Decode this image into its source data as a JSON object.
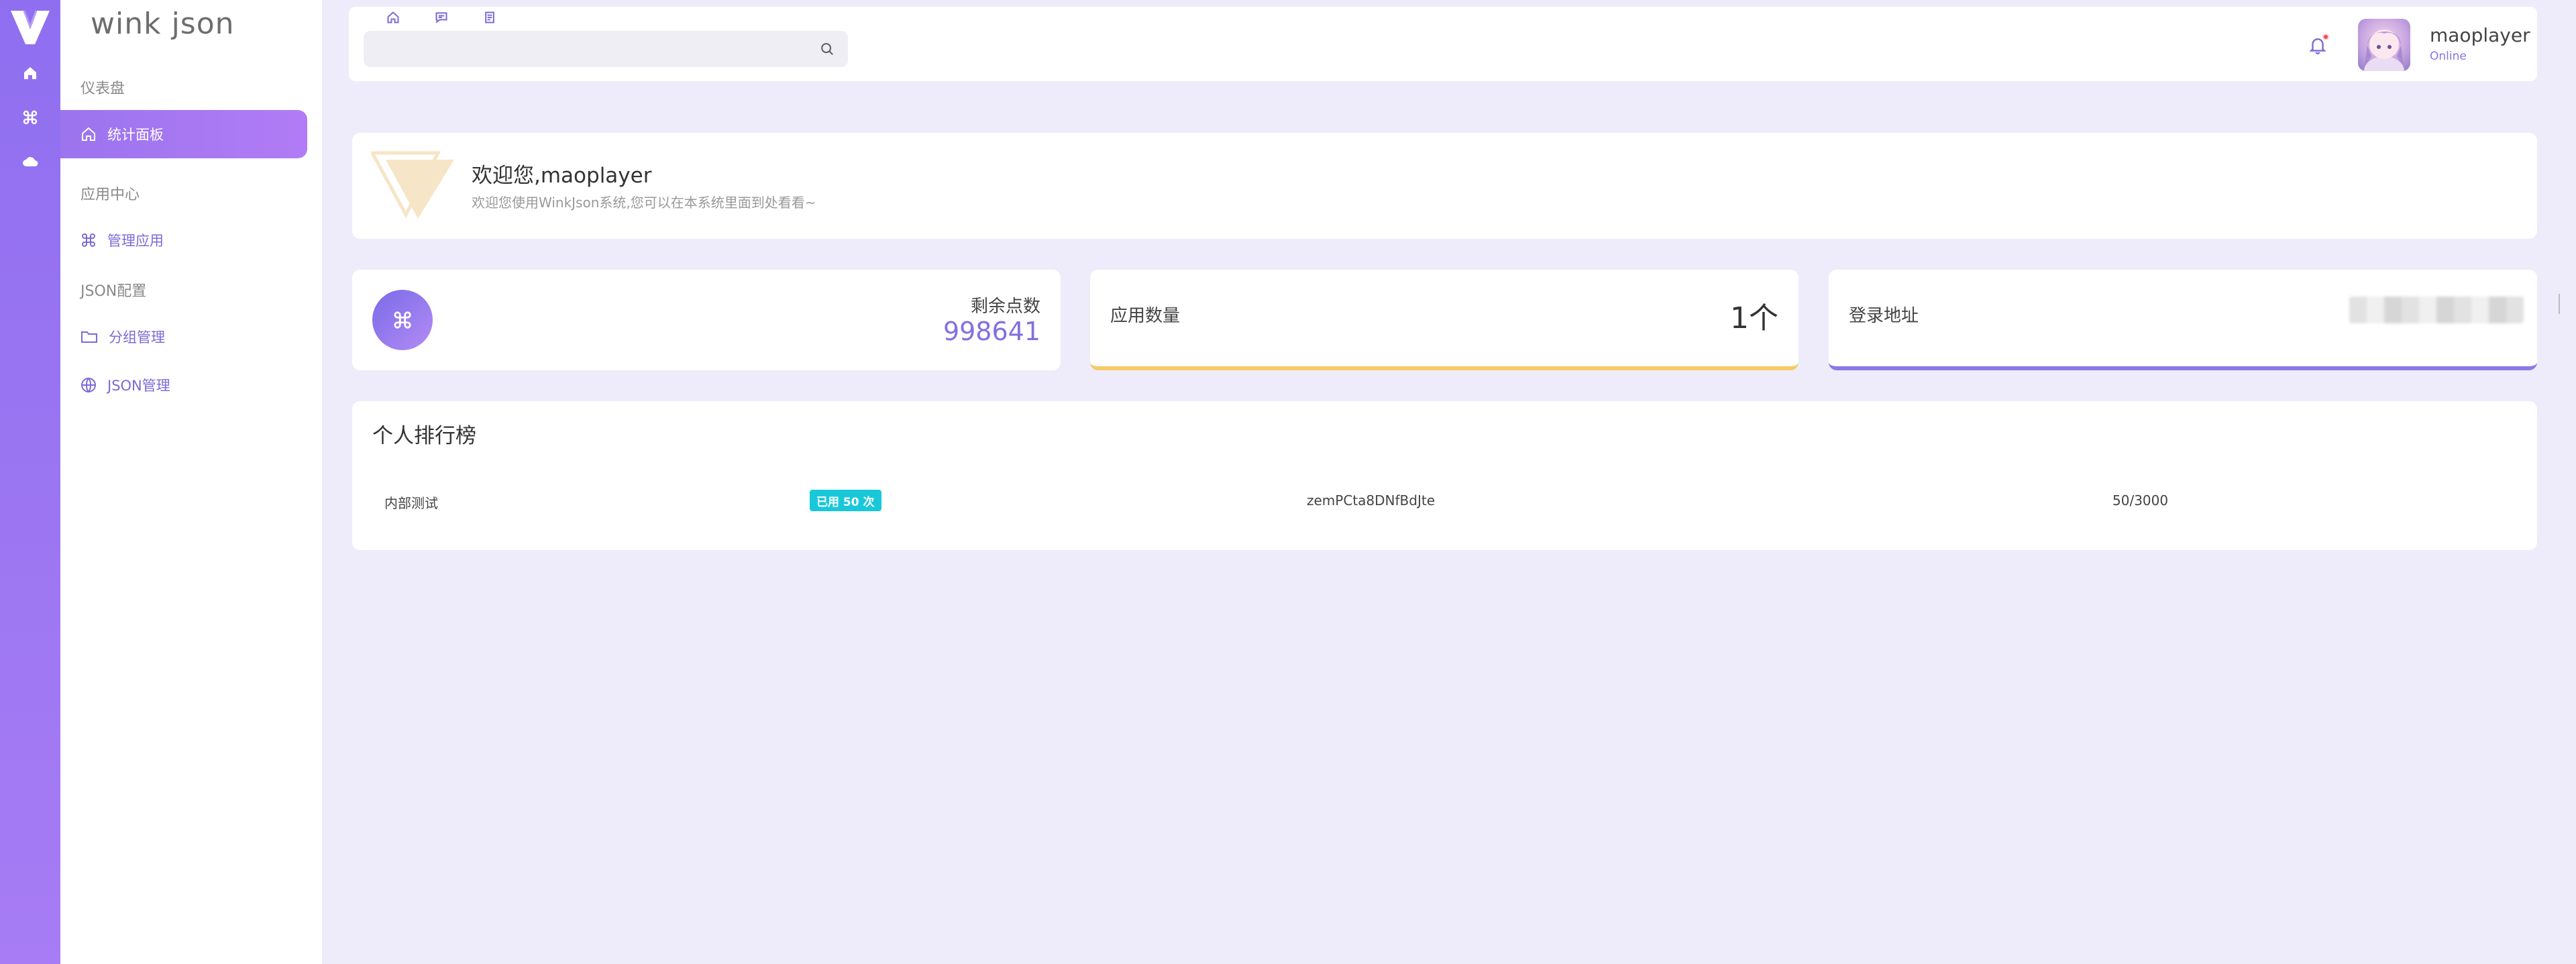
{
  "rail": {
    "icons": [
      "logo-v-icon",
      "home-icon",
      "command-icon",
      "cloud-icon"
    ]
  },
  "sidebar": {
    "brand": "wink json",
    "groups": [
      {
        "title": "仪表盘",
        "items": [
          {
            "label": "统计面板",
            "icon": "home-icon",
            "active": true
          }
        ]
      },
      {
        "title": "应用中心",
        "items": [
          {
            "label": "管理应用",
            "icon": "command-icon",
            "active": false
          }
        ]
      },
      {
        "title": "JSON配置",
        "items": [
          {
            "label": "分组管理",
            "icon": "folder-icon",
            "active": false
          },
          {
            "label": "JSON管理",
            "icon": "globe-icon",
            "active": false
          }
        ]
      }
    ]
  },
  "topbar": {
    "tabs": [
      "home-icon",
      "message-icon",
      "document-icon"
    ],
    "search": {
      "placeholder": "",
      "value": ""
    },
    "user": {
      "name": "maoplayer",
      "status": "Online"
    }
  },
  "welcome": {
    "title": "欢迎您,maoplayer",
    "subtitle": "欢迎您使用WinkJson系统,您可以在本系统里面到处看看~"
  },
  "stats": {
    "points_label": "剩余点数",
    "points_value": "998641",
    "apps_label": "应用数量",
    "apps_value": "1个",
    "login_label": "登录地址"
  },
  "ranking": {
    "title": "个人排行榜",
    "rows": [
      {
        "name": "内部测试",
        "badge": "已用 50 次",
        "key": "zemPCta8DNfBdJte",
        "usage": "50/3000"
      }
    ]
  },
  "colors": {
    "accent": "#8f6ff0",
    "accent_light": "#b17cf6",
    "yellow": "#f6ca64",
    "badge": "#18c8d9",
    "background": "#eeecfa"
  }
}
